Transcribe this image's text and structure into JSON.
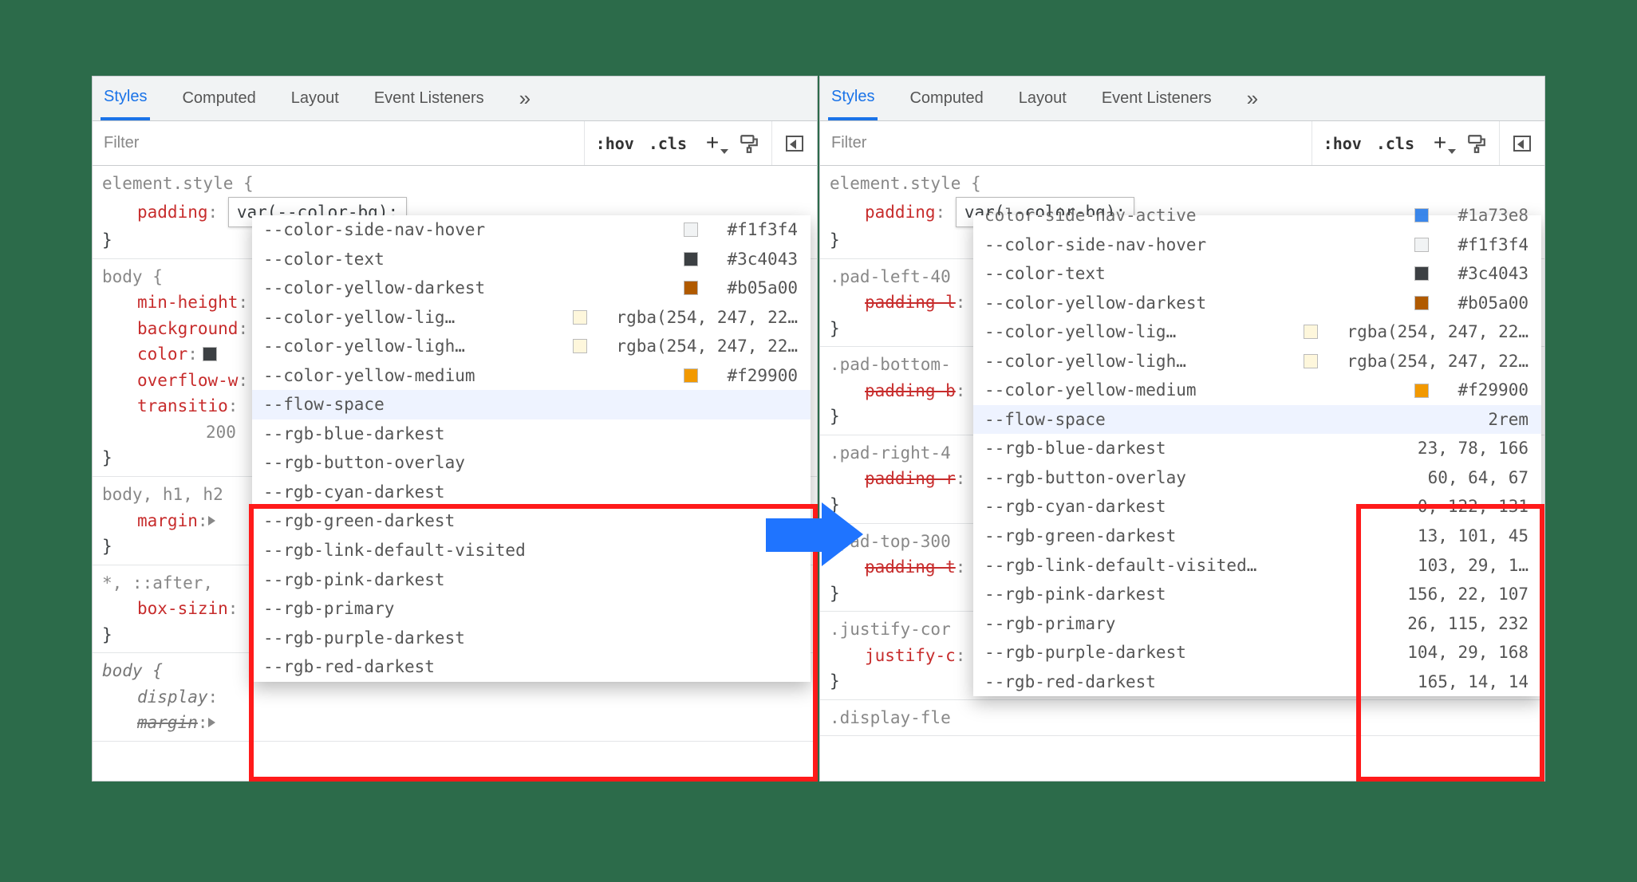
{
  "tabs": [
    "Styles",
    "Computed",
    "Layout",
    "Event Listeners"
  ],
  "active_tab": "Styles",
  "filter": {
    "placeholder": "Filter",
    "hov": ":hov",
    "cls": ".cls"
  },
  "element_style": {
    "selector": "element.style {",
    "prop": "padding",
    "value_edit": "var(--color-bg);",
    "close": "}"
  },
  "left_rules": [
    {
      "selector": "body {",
      "props": [
        {
          "name": "min-height"
        },
        {
          "name": "background"
        },
        {
          "name": "color",
          "swatch": "#3c4043"
        },
        {
          "name": "overflow-w"
        },
        {
          "name": "transitio"
        },
        {
          "indent_text": "200"
        }
      ],
      "close": "}"
    },
    {
      "selector": "body, h1, h2",
      "props": [
        {
          "name": "margin",
          "tri": true
        }
      ],
      "close": "}"
    },
    {
      "selector": "*, ::after,",
      "props": [
        {
          "name": "box-sizin"
        }
      ],
      "close": "}"
    },
    {
      "selector": "body {",
      "italic": true,
      "props": [
        {
          "name": "display",
          "italic": true
        },
        {
          "name": "margin",
          "italic": true,
          "strike": true,
          "tri": true
        }
      ]
    }
  ],
  "right_rules": [
    {
      "selector": ".pad-left-40",
      "props": [
        {
          "name": "padding-l",
          "strike": true
        }
      ],
      "close": "}"
    },
    {
      "selector": ".pad-bottom-",
      "props": [
        {
          "name": "padding-b",
          "strike": true
        }
      ],
      "close": "}"
    },
    {
      "selector": ".pad-right-4",
      "props": [
        {
          "name": "padding-r",
          "strike": true
        }
      ],
      "close": "}"
    },
    {
      "selector": ".pad-top-300",
      "props": [
        {
          "name": "padding-t",
          "strike": true
        }
      ],
      "close": "}"
    },
    {
      "selector": ".justify-cor",
      "props": [
        {
          "name": "justify-c"
        }
      ],
      "close": "}"
    },
    {
      "selector": ".display-fle"
    }
  ],
  "dropdown_top_partial": {
    "name_cut": "color-side-nav-active",
    "swatch": "#1a73e8",
    "value_cut": "#1a73e8"
  },
  "dropdown_common": [
    {
      "name": "--color-side-nav-hover",
      "swatch": "#f1f3f4",
      "value": "#f1f3f4"
    },
    {
      "name": "--color-text",
      "swatch": "#3c4043",
      "value": "#3c4043"
    },
    {
      "name": "--color-yellow-darkest",
      "swatch": "#b05a00",
      "value": "#b05a00"
    },
    {
      "name": "--color-yellow-lig…",
      "swatch": "rgba(254,247,220,1)",
      "value": "rgba(254, 247, 22…"
    },
    {
      "name": "--color-yellow-ligh…",
      "swatch": "rgba(254,247,220,1)",
      "value": "rgba(254, 247, 22…"
    },
    {
      "name": "--color-yellow-medium",
      "swatch": "#f29900",
      "value": "#f29900"
    }
  ],
  "dropdown_rest_left": [
    {
      "name": "--flow-space",
      "selected": true
    },
    {
      "name": "--rgb-blue-darkest"
    },
    {
      "name": "--rgb-button-overlay"
    },
    {
      "name": "--rgb-cyan-darkest"
    },
    {
      "name": "--rgb-green-darkest"
    },
    {
      "name": "--rgb-link-default-visited"
    },
    {
      "name": "--rgb-pink-darkest"
    },
    {
      "name": "--rgb-primary"
    },
    {
      "name": "--rgb-purple-darkest"
    },
    {
      "name": "--rgb-red-darkest"
    }
  ],
  "dropdown_rest_right": [
    {
      "name": "--flow-space",
      "value": "2rem",
      "selected": true
    },
    {
      "name": "--rgb-blue-darkest",
      "value": "23, 78, 166"
    },
    {
      "name": "--rgb-button-overlay",
      "value": "60, 64, 67"
    },
    {
      "name": "--rgb-cyan-darkest",
      "value": "0, 122, 131"
    },
    {
      "name": "--rgb-green-darkest",
      "value": "13, 101, 45"
    },
    {
      "name": "--rgb-link-default-visited…",
      "value": "103, 29, 1…"
    },
    {
      "name": "--rgb-pink-darkest",
      "value": "156, 22, 107"
    },
    {
      "name": "--rgb-primary",
      "value": "26, 115, 232"
    },
    {
      "name": "--rgb-purple-darkest",
      "value": "104, 29, 168"
    },
    {
      "name": "--rgb-red-darkest",
      "value": "165, 14, 14"
    }
  ]
}
